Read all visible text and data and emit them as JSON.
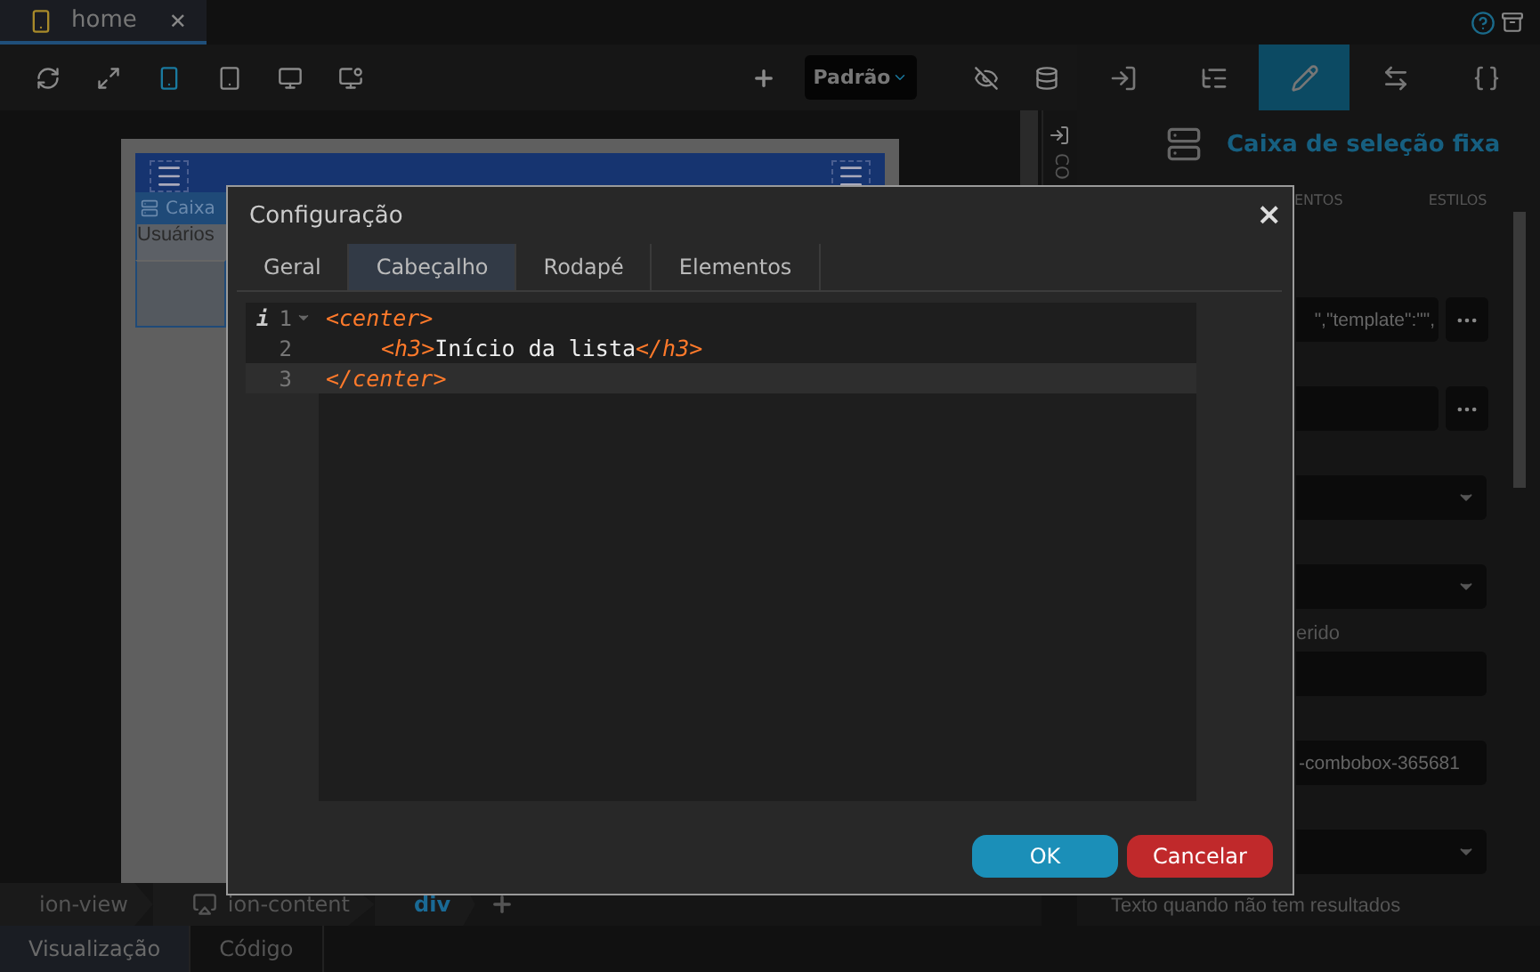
{
  "file_tab": {
    "label": "home",
    "close": "✕"
  },
  "toolbar": {
    "devices": [
      {
        "selected": true
      },
      {
        "selected": false
      },
      {
        "selected": false
      },
      {
        "selected": false
      }
    ],
    "theme_select": "Padrão"
  },
  "canvas": {
    "strip_label": "Caixa",
    "content": "Usuários"
  },
  "side_strip": {
    "label": "CO"
  },
  "breadcrumb": [
    {
      "label": "ion-view",
      "selected": false
    },
    {
      "label": "ion-content",
      "selected": false
    },
    {
      "label": "div",
      "selected": true
    }
  ],
  "view_tabs": [
    {
      "label": "Visualização",
      "selected": true
    },
    {
      "label": "Código",
      "selected": false
    }
  ],
  "inspector": {
    "tools": [
      {
        "selected": false
      },
      {
        "selected": false
      },
      {
        "selected": true
      },
      {
        "selected": false
      },
      {
        "selected": false
      }
    ],
    "title": "Caixa de seleção fixa",
    "tabs": [
      "ENTOS",
      "ESTILOS"
    ],
    "rows": [
      {
        "kind": "input",
        "value": "\",\"template\":\"\",",
        "more_button": true
      },
      {
        "kind": "input",
        "more_button": true
      },
      {
        "kind": "select"
      },
      {
        "kind": "select"
      },
      {
        "kind": "label",
        "text": "erido"
      },
      {
        "kind": "input",
        "more_button": false
      },
      {
        "kind": "input",
        "value": "-combobox-365681",
        "more_button": false
      },
      {
        "kind": "select"
      },
      {
        "kind": "label",
        "text": "Texto quando não tem resultados"
      }
    ]
  },
  "dialog": {
    "title": "Configuração",
    "close": "×",
    "tabs": [
      {
        "label": "Geral",
        "selected": false
      },
      {
        "label": "Cabeçalho",
        "selected": true
      },
      {
        "label": "Rodapé",
        "selected": false
      },
      {
        "label": "Elementos",
        "selected": false
      }
    ],
    "code": [
      {
        "number": "1",
        "marker": "i",
        "foldable": true,
        "indented": false,
        "active": false,
        "tokens": [
          {
            "kind": "tag",
            "text": "<center>"
          }
        ]
      },
      {
        "number": "2",
        "foldable": false,
        "indented": true,
        "active": false,
        "tokens": [
          {
            "kind": "tag",
            "text": "<h3>"
          },
          {
            "kind": "text",
            "text": "Início da lista"
          },
          {
            "kind": "tag",
            "text": "</h3>"
          }
        ]
      },
      {
        "number": "3",
        "foldable": false,
        "indented": false,
        "active": true,
        "tokens": [
          {
            "kind": "tag",
            "text": "</center>"
          }
        ]
      }
    ],
    "buttons": [
      {
        "kind": "primary",
        "label": "OK"
      },
      {
        "kind": "danger",
        "label": "Cancelar"
      }
    ]
  }
}
